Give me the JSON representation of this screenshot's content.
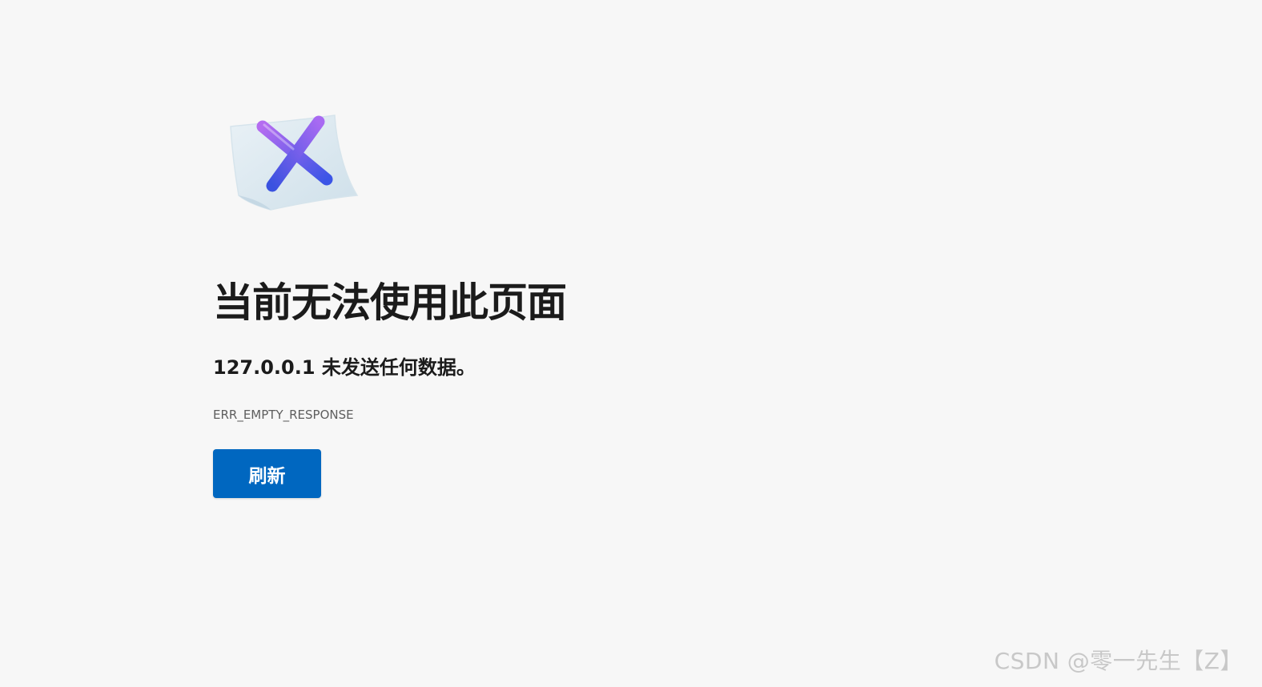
{
  "error_page": {
    "icon": "document-x-icon",
    "headline": "当前无法使用此页面",
    "subheadline": "127.0.0.1 未发送任何数据。",
    "error_code": "ERR_EMPTY_RESPONSE",
    "refresh_label": "刷新"
  },
  "watermark": {
    "text": "CSDN @零一先生【Z】"
  },
  "colors": {
    "background": "#f7f7f7",
    "button": "#0067c0",
    "text": "#1b1b1b",
    "muted_text": "#5e5e5e",
    "icon_gradient_start": "#9b6bf0",
    "icon_gradient_end": "#3f5be8"
  }
}
